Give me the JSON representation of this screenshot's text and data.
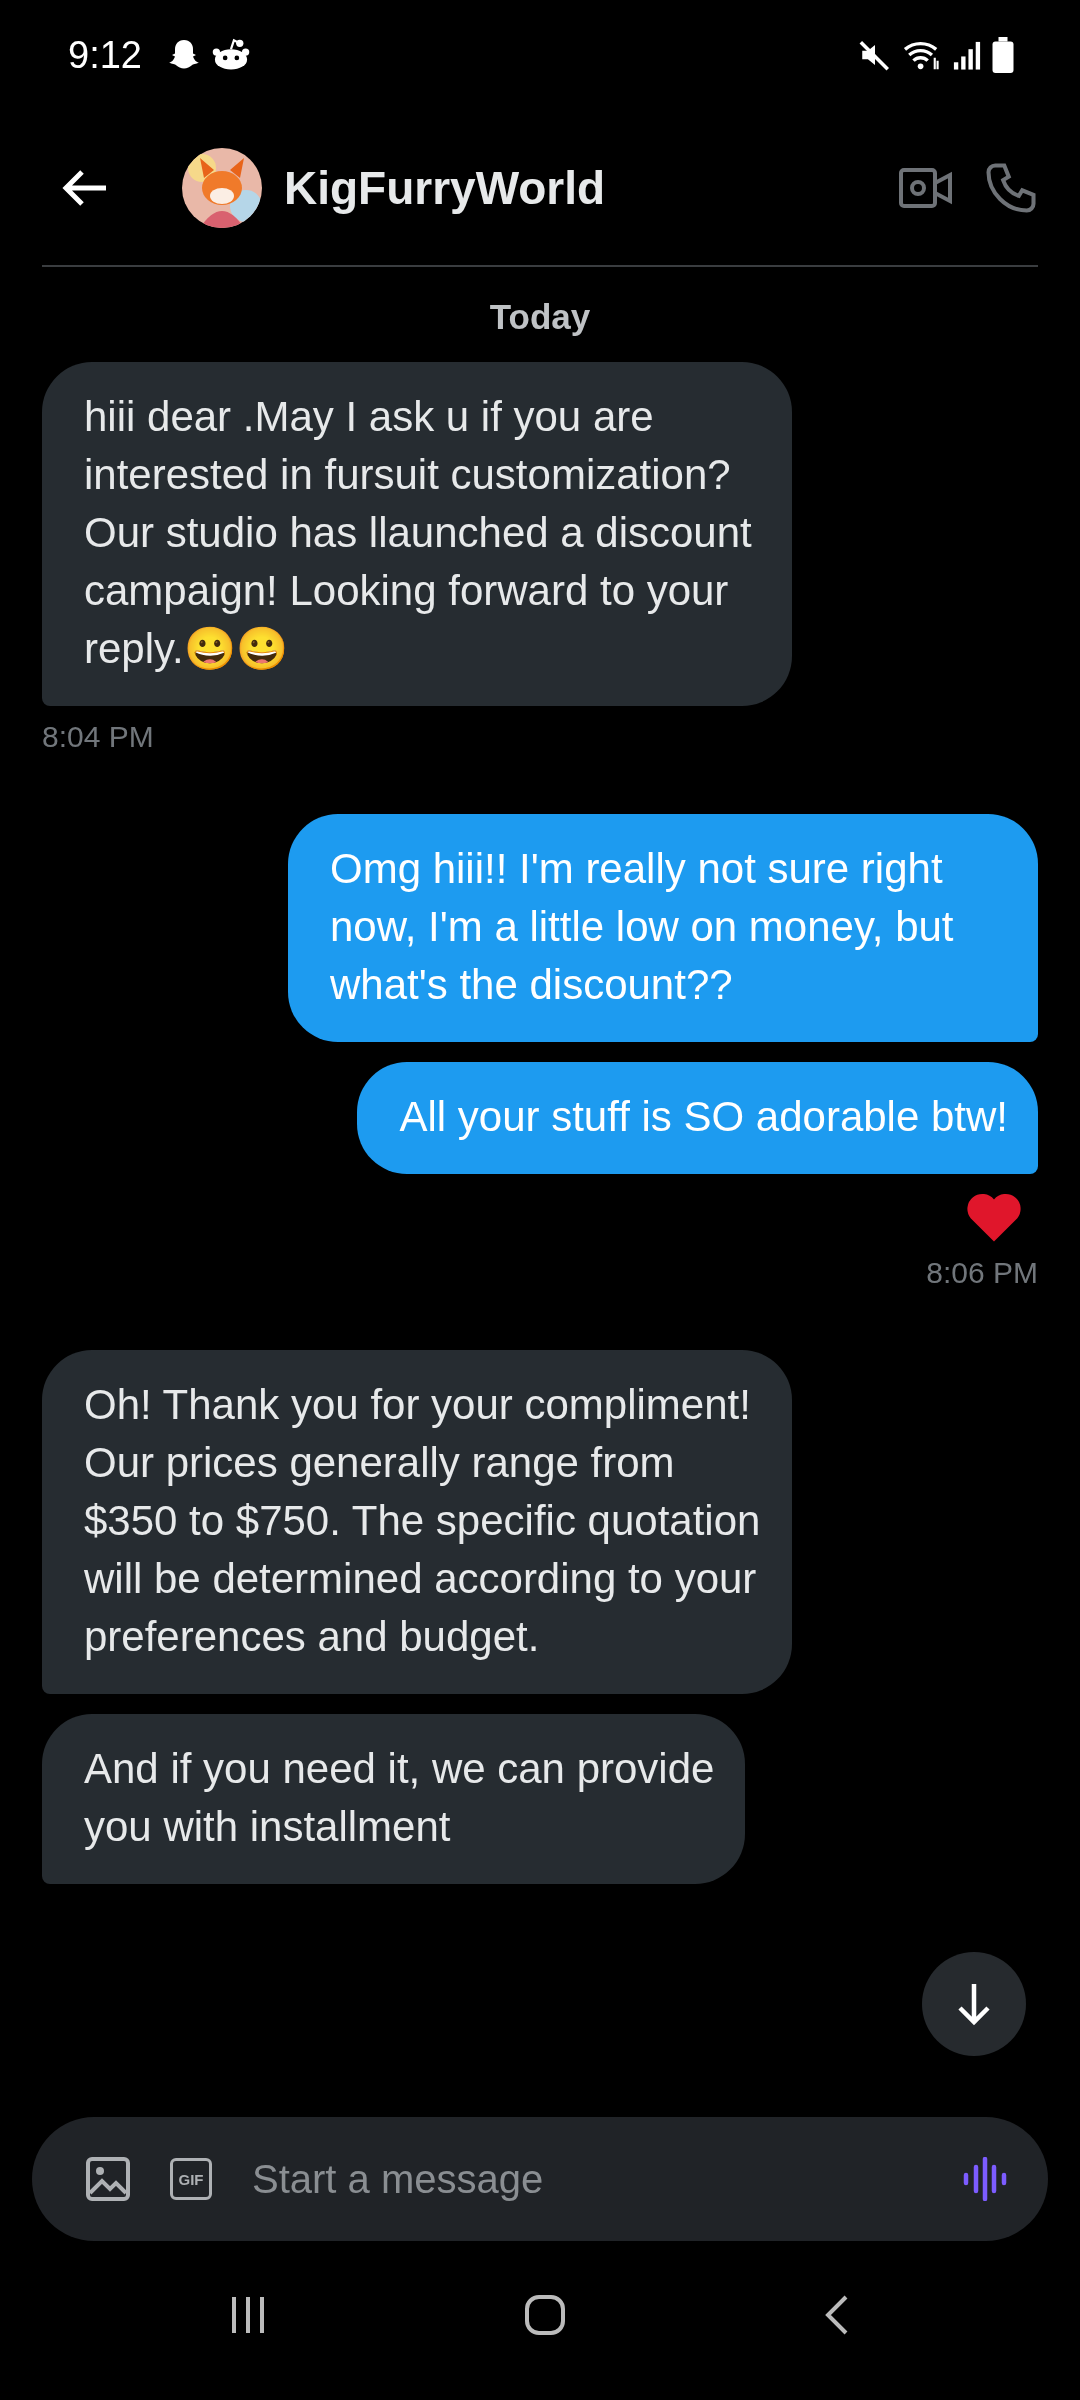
{
  "status_bar": {
    "time": "9:12"
  },
  "header": {
    "name": "KigFurryWorld"
  },
  "day_label": "Today",
  "messages": [
    {
      "kind": "received",
      "text": "hiii dear .May I ask u if you are interested in fursuit customization?Our studio has llaunched a discount campaign! Looking forward to your reply.😀😀",
      "time": "8:04 PM"
    },
    {
      "kind": "sent",
      "text": "Omg hiii!! I'm really not sure right now, I'm a little low on money, but what's the discount??"
    },
    {
      "kind": "sent",
      "text": "All your stuff is SO adorable btw!",
      "reacted": true,
      "time": "8:06 PM"
    },
    {
      "kind": "received",
      "text": "Oh! Thank you for your compliment! Our prices generally range from $350 to $750. The specific quotation will be determined according to your preferences and budget."
    },
    {
      "kind": "received",
      "text": "And if you need it, we can provide you with installment"
    }
  ],
  "composer": {
    "placeholder": "Start a message",
    "gif_label": "GIF"
  }
}
